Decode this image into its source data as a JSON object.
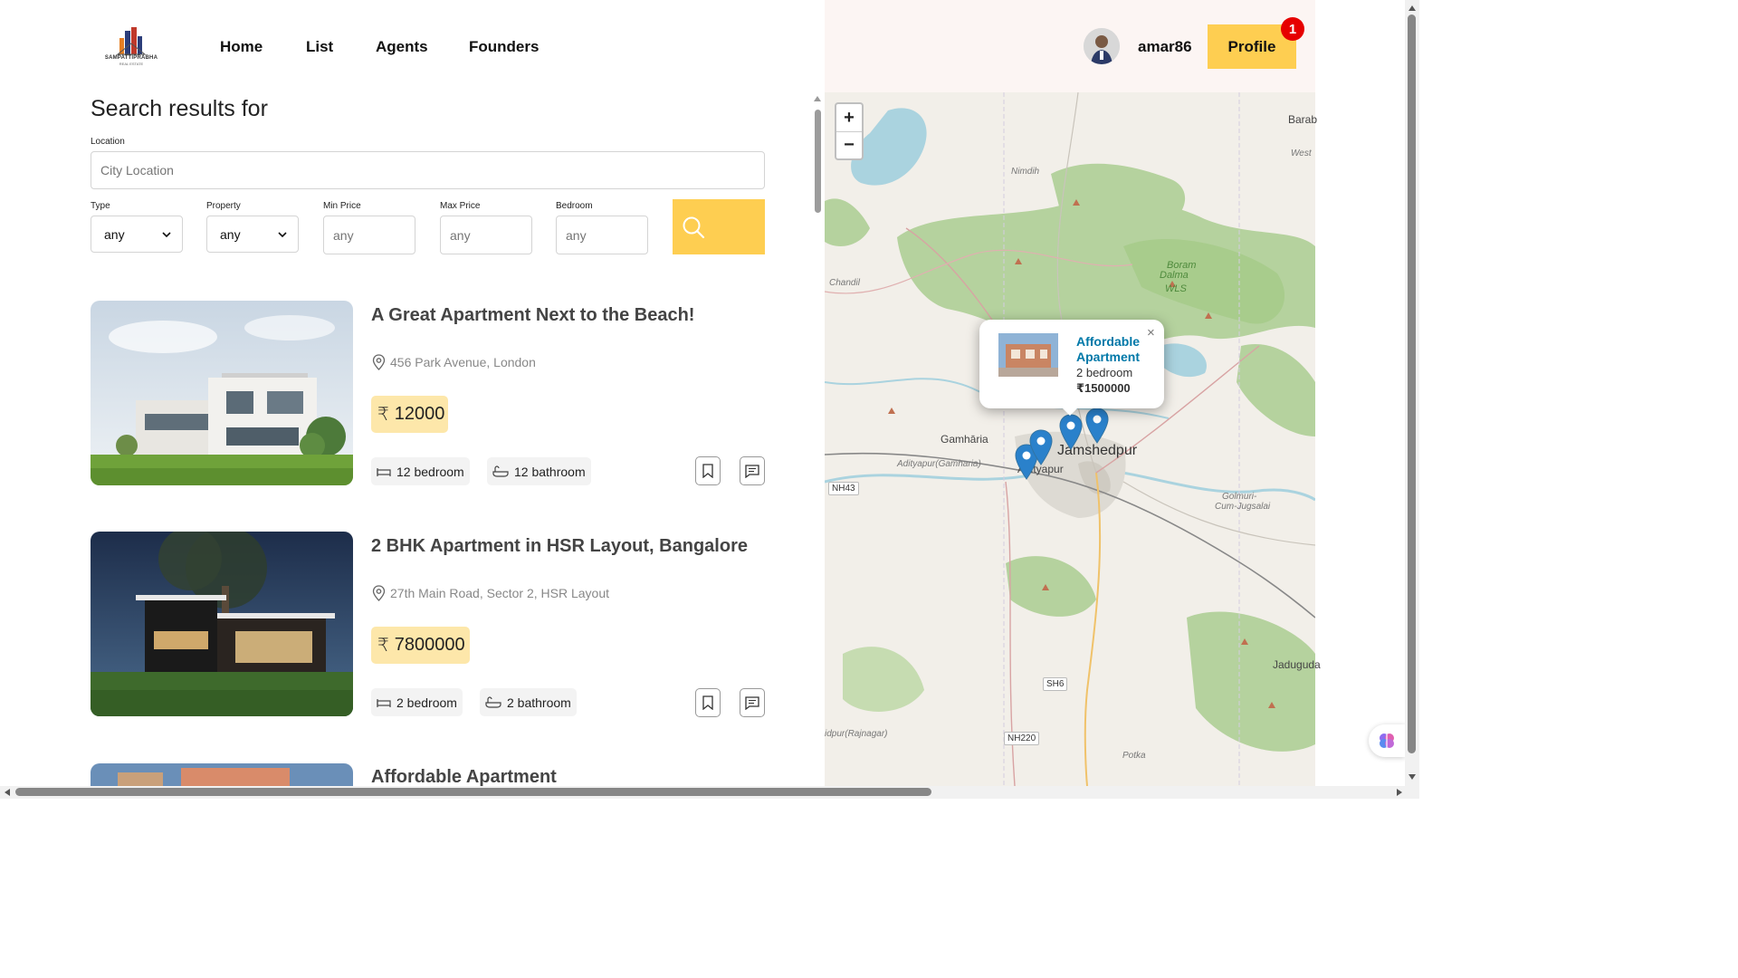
{
  "brand": {
    "name": "SAMPATTIPRABHA",
    "tagline": "REAL ESTATE"
  },
  "nav": {
    "items": [
      "Home",
      "List",
      "Agents",
      "Founders"
    ]
  },
  "user": {
    "username": "amar86",
    "profile_label": "Profile",
    "notifications": "1"
  },
  "search": {
    "title": "Search results for",
    "location_label": "Location",
    "location_placeholder": "City Location",
    "type_label": "Type",
    "type_value": "any",
    "property_label": "Property",
    "property_value": "any",
    "min_price_label": "Min Price",
    "min_price_placeholder": "any",
    "max_price_label": "Max Price",
    "max_price_placeholder": "any",
    "bedroom_label": "Bedroom",
    "bedroom_placeholder": "any"
  },
  "listings": [
    {
      "title": "A Great Apartment Next to the Beach!",
      "address": "456 Park Avenue, London",
      "price": "12000",
      "bedrooms": "12 bedroom",
      "bathrooms": "12 bathroom"
    },
    {
      "title": "2 BHK Apartment in HSR Layout, Bangalore",
      "address": "27th Main Road, Sector 2, HSR Layout",
      "price": "7800000",
      "bedrooms": "2 bedroom",
      "bathrooms": "2 bathroom"
    },
    {
      "title": "Affordable Apartment"
    }
  ],
  "currency_symbol": "₹",
  "map": {
    "zoom_in": "+",
    "zoom_out": "−",
    "popup": {
      "title": "Affordable Apartment",
      "bedrooms": "2 bedroom",
      "price": "₹1500000",
      "close": "×"
    },
    "labels": {
      "jamshedpur": "Jamshedpur",
      "gamharia": "Gamhāria",
      "adityapur_gamharia": "Adityapur(Gamharia)",
      "adityapur": "Adityapur",
      "nimdih": "Nimdih",
      "chandil": "Chandil",
      "boram": "Boram",
      "dalma": "Dalma",
      "wls": "WLS",
      "golmuri": "Golmuri-",
      "cum_jugsalai": "Cum-Jugsalai",
      "jaduguda": "Jaduguda",
      "potka": "Potka",
      "barab": "Barab",
      "west": "West",
      "rajnagar": "idpur(Rajnagar)",
      "nh43": "NH43",
      "sh6": "SH6",
      "nh220": "NH220"
    }
  },
  "colors": {
    "accent": "#fece51",
    "price_bg": "#fde7aa",
    "right_panel": "#fcf5f3",
    "link": "#0078a8",
    "badge": "#e60000",
    "marker": "#2a81cb"
  }
}
